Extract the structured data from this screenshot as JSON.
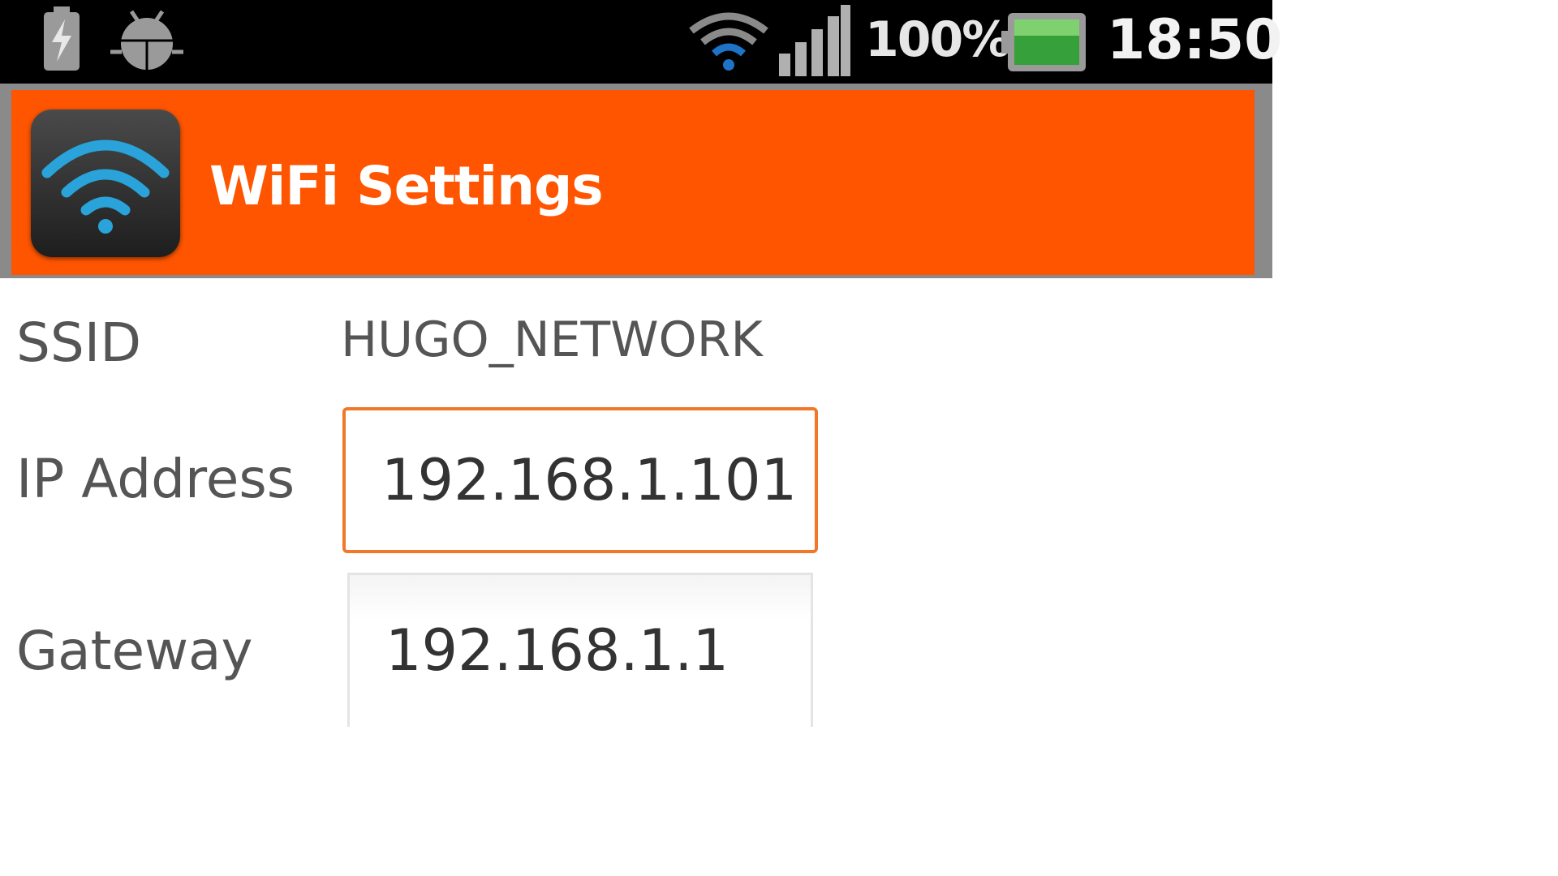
{
  "status_bar": {
    "battery_percent": "100%",
    "time": "18:50",
    "icons": [
      "battery-charging-icon",
      "android-debug-icon",
      "wifi-signal-icon",
      "cell-signal-icon",
      "battery-icon"
    ]
  },
  "app_bar": {
    "title": "WiFi Settings",
    "icon": "wifi-app-icon",
    "background_color": "#ff5500"
  },
  "form": {
    "ssid": {
      "label": "SSID",
      "value": "HUGO_NETWORK"
    },
    "ip_address": {
      "label": "IP Address",
      "value": "192.168.1.101"
    },
    "gateway": {
      "label": "Gateway",
      "value": "192.168.1.1"
    }
  },
  "colors": {
    "accent": "#ff5500",
    "focus_border": "#f07828",
    "wifi_blue": "#29a3d9"
  }
}
